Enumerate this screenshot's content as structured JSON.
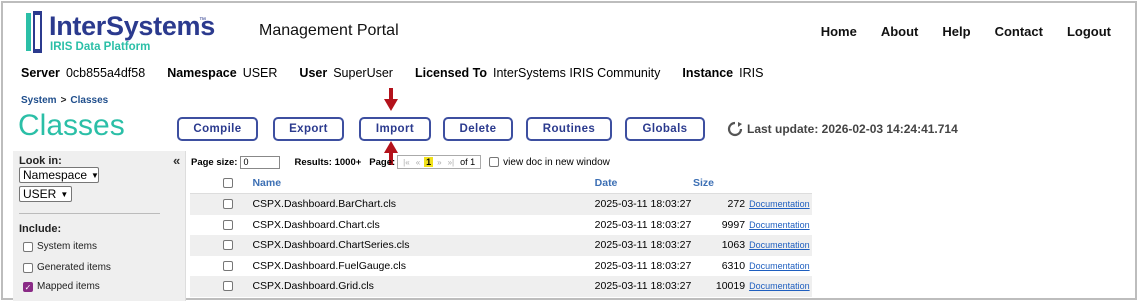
{
  "header": {
    "logo_text": "InterSystems",
    "logo_subtitle": "IRIS Data Platform",
    "portal_title": "Management Portal",
    "nav": [
      "Home",
      "About",
      "Help",
      "Contact",
      "Logout"
    ]
  },
  "infobar": {
    "server_label": "Server",
    "server_value": "0cb855a4df58",
    "namespace_label": "Namespace",
    "namespace_value": "USER",
    "user_label": "User",
    "user_value": "SuperUser",
    "licensed_label": "Licensed To",
    "licensed_value": "InterSystems IRIS Community",
    "instance_label": "Instance",
    "instance_value": "IRIS"
  },
  "breadcrumb": {
    "system": "System",
    "sep": ">",
    "current": "Classes"
  },
  "page_title": "Classes",
  "toolbar": {
    "buttons": [
      "Compile",
      "Export",
      "Import",
      "Delete",
      "Routines",
      "Globals"
    ]
  },
  "last_update": "Last update: 2026-02-03 14:24:41.714",
  "sidebar": {
    "collapse": "«",
    "look_in_label": "Look in:",
    "look_in_value": "Namespace",
    "namespace_value": "USER",
    "include_label": "Include:",
    "options": [
      {
        "label": "System items",
        "checked": false
      },
      {
        "label": "Generated items",
        "checked": false
      },
      {
        "label": "Mapped items",
        "checked": true
      }
    ]
  },
  "pager": {
    "page_size_label": "Page size:",
    "page_size_value": "0",
    "results": "Results: 1000+",
    "page_label": "Page:",
    "first": "|«",
    "prev": "«",
    "current_page": "1",
    "next": "»",
    "last": "»|",
    "of": "of 1",
    "view_doc_label": "view doc in new window"
  },
  "table": {
    "headers": {
      "name": "Name",
      "date": "Date",
      "size": "Size"
    },
    "rows": [
      {
        "name": "CSPX.Dashboard.BarChart.cls",
        "date": "2025-03-11 18:03:27",
        "size": "272",
        "doc": "Documentation"
      },
      {
        "name": "CSPX.Dashboard.Chart.cls",
        "date": "2025-03-11 18:03:27",
        "size": "9997",
        "doc": "Documentation"
      },
      {
        "name": "CSPX.Dashboard.ChartSeries.cls",
        "date": "2025-03-11 18:03:27",
        "size": "1063",
        "doc": "Documentation"
      },
      {
        "name": "CSPX.Dashboard.FuelGauge.cls",
        "date": "2025-03-11 18:03:27",
        "size": "6310",
        "doc": "Documentation"
      },
      {
        "name": "CSPX.Dashboard.Grid.cls",
        "date": "2025-03-11 18:03:27",
        "size": "10019",
        "doc": "Documentation"
      }
    ]
  },
  "colors": {
    "brand": "#2b3a8e",
    "accent": "#2bbfa7",
    "arrow": "#b3121b",
    "link": "#1f5fbf"
  }
}
